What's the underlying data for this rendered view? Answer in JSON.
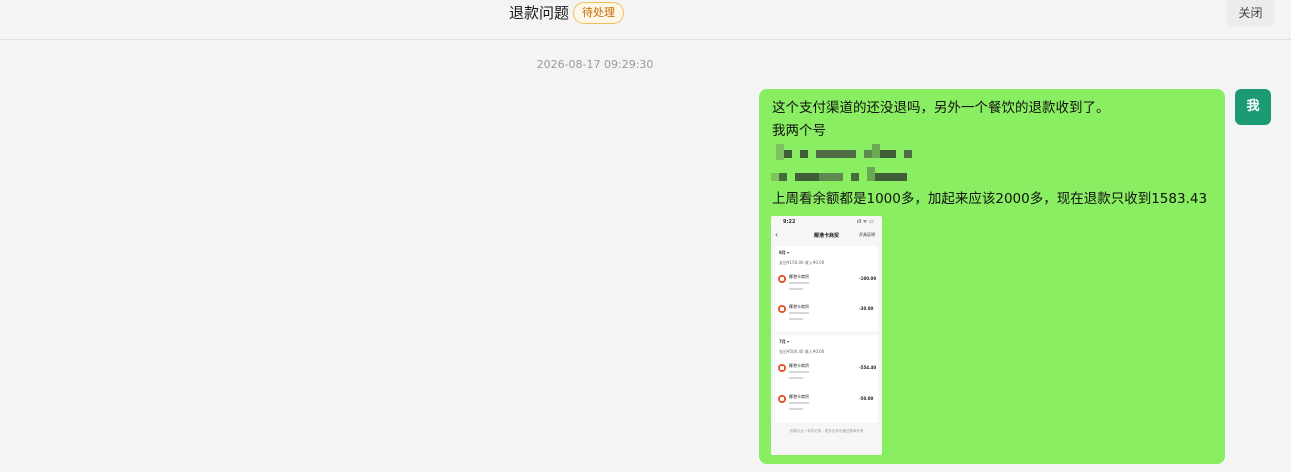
{
  "header": {
    "title": "退款问题",
    "status_badge": "待处理",
    "close_label": "关闭"
  },
  "chat": {
    "timestamp": "2026-08-17 09:29:30",
    "avatar_label": "我",
    "message": {
      "line1": "这个支付渠道的还没退吗，另外一个餐饮的退款收到了。",
      "line2": "我两个号",
      "line5": "上周看余额都是1000多，加起来应该2000多，现在退款只收到1583.43"
    },
    "screenshot": {
      "status_time": "9:22",
      "status_icons": "ıll ᯤ ▭",
      "back_icon": "‹",
      "nav_title": "椰港卡商贸",
      "nav_action": "开具证明",
      "month1": "8月 ▾",
      "month1_summary": "支出¥150.00   收入¥0.00",
      "rows1": [
        {
          "merchant": "椰港卡商贸",
          "amount": "-100.00"
        },
        {
          "merchant": "椰港卡商贸",
          "amount": "-30.00"
        }
      ],
      "month2": "7月 ▾",
      "month2_summary": "支出¥504.40   收入¥0.00",
      "rows2": [
        {
          "merchant": "椰港卡商贸",
          "amount": "-554.40"
        },
        {
          "merchant": "椰港卡商贸",
          "amount": "-50.00"
        }
      ],
      "footer": "仅展示近一年内记录，更多记录可通过账单查询"
    },
    "colors": {
      "bubble": "#8aee62",
      "avatar": "#1c9a74",
      "badge_text": "#c26a00",
      "badge_border": "#f0c060"
    }
  }
}
